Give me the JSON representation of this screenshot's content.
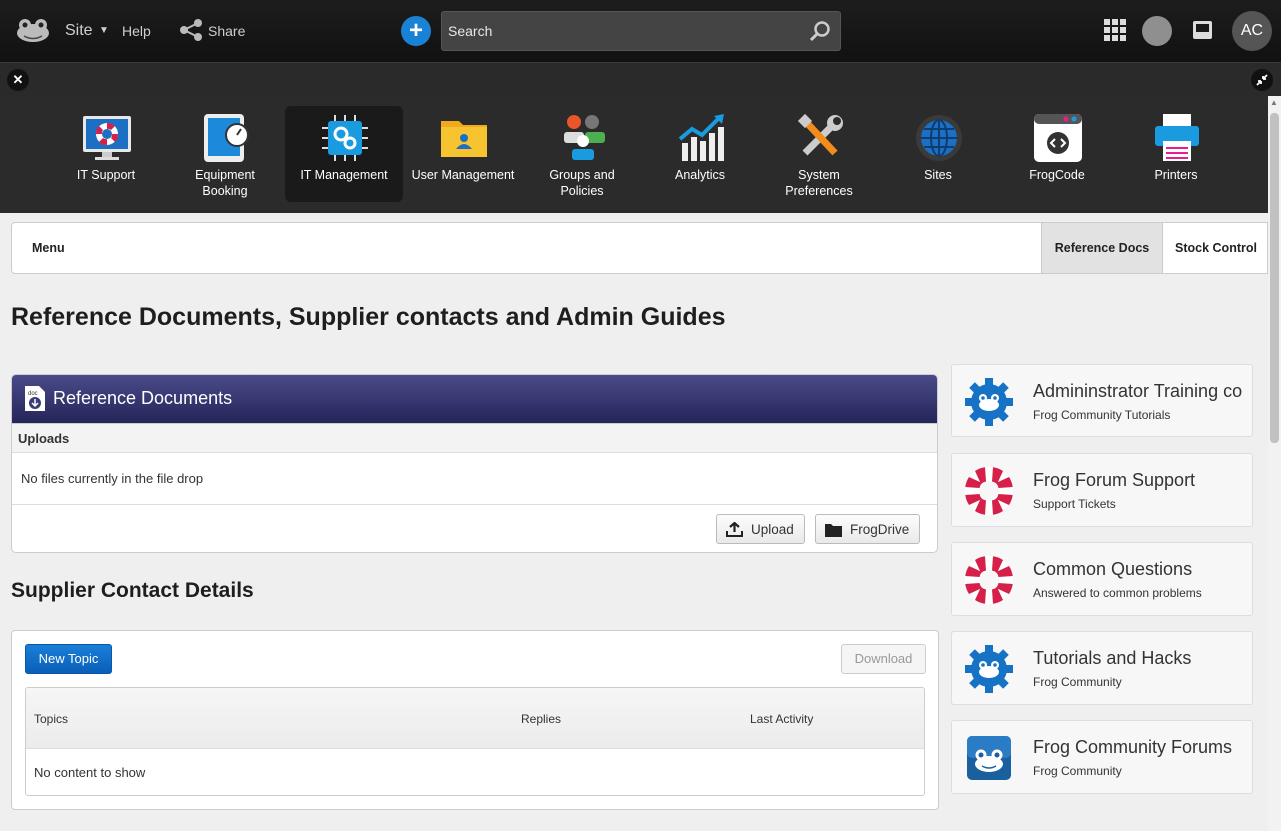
{
  "topbar": {
    "site_label": "Site",
    "help_label": "Help",
    "share_label": "Share",
    "search_placeholder": "Search",
    "user_initials": "AC"
  },
  "apps": [
    {
      "label": "IT Support",
      "icon": "lifebuoy-monitor-icon"
    },
    {
      "label": "Equipment Booking",
      "icon": "tablet-clock-icon"
    },
    {
      "label": "IT Management",
      "icon": "chip-gears-icon"
    },
    {
      "label": "User Management",
      "icon": "user-folder-icon"
    },
    {
      "label": "Groups and Policies",
      "icon": "groups-icon"
    },
    {
      "label": "Analytics",
      "icon": "analytics-icon"
    },
    {
      "label": "System Preferences",
      "icon": "tools-icon"
    },
    {
      "label": "Sites",
      "icon": "globe-icon"
    },
    {
      "label": "FrogCode",
      "icon": "code-window-icon"
    },
    {
      "label": "Printers",
      "icon": "printer-icon"
    }
  ],
  "nav": {
    "menu_label": "Menu",
    "tabs": [
      "Reference Docs",
      "Stock Control"
    ]
  },
  "page_title": "Reference Documents, Supplier contacts and Admin Guides",
  "reference_docs": {
    "title": "Reference Documents",
    "uploads_label": "Uploads",
    "empty_text": "No files currently in the file drop",
    "upload_label": "Upload",
    "frogdrive_label": "FrogDrive"
  },
  "supplier": {
    "title": "Supplier Contact Details",
    "new_topic_label": "New Topic",
    "download_label": "Download",
    "columns": [
      "Topics",
      "Replies",
      "Last Activity"
    ],
    "empty_text": "No content to show"
  },
  "cards": [
    {
      "title": "Admininstrator Training co",
      "subtitle": "Frog Community Tutorials",
      "icon": "frog-gear-icon"
    },
    {
      "title": "Frog Forum Support",
      "subtitle": "Support Tickets",
      "icon": "lifebuoy-icon"
    },
    {
      "title": "Common Questions",
      "subtitle": "Answered to common problems",
      "icon": "lifebuoy-icon"
    },
    {
      "title": "Tutorials and Hacks",
      "subtitle": "Frog Community",
      "icon": "frog-gear-icon"
    },
    {
      "title": "Frog Community Forums",
      "subtitle": "Frog Community",
      "icon": "frog-tile-icon"
    }
  ],
  "colors": {
    "accent_blue": "#1a82d4",
    "panel_header": "#3a3a78",
    "lifebuoy_red": "#d6204a"
  }
}
